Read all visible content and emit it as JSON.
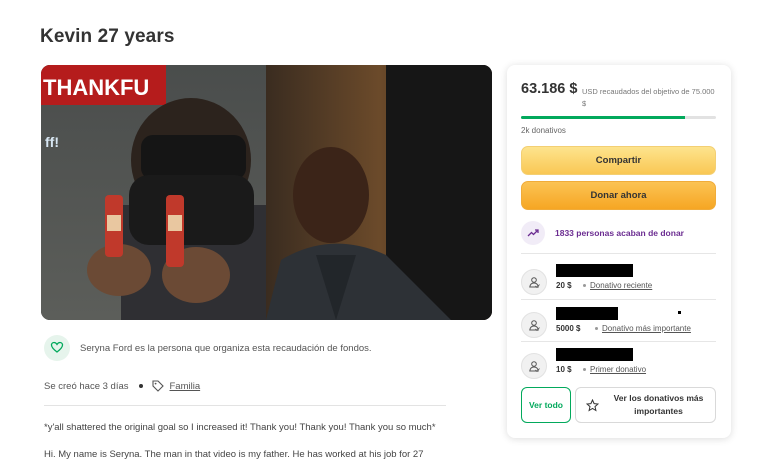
{
  "page": {
    "title": "Kevin 27 years"
  },
  "hero": {
    "sign_text": "THANKFU",
    "side_text": "ff!"
  },
  "organizer": {
    "text": "Seryna Ford es la persona que organiza esta recaudación de fondos."
  },
  "meta": {
    "created": "Se creó hace 3 días",
    "category": "Familia"
  },
  "story": {
    "paragraphs": [
      "*y'all shattered the original goal so I increased it! Thank you! Thank you! Thank you so much*",
      "Hi. My name is Seryna. The man in that video is my father. He has worked at his job for 27"
    ]
  },
  "campaign": {
    "raised_amount": "63.186 $",
    "raised_text": "USD recaudados del objetivo de 75.000 $",
    "progress_fraction": 0.8425,
    "donation_count": "2k donativos",
    "share_label": "Compartir",
    "donate_label": "Donar ahora",
    "recent_text": "1833 personas acaban de donar",
    "donors": [
      {
        "amount": "20 $",
        "label": "Donativo reciente"
      },
      {
        "amount": "5000 $",
        "label": "Donativo más importante"
      },
      {
        "amount": "10 $",
        "label": "Primer donativo"
      }
    ],
    "see_all_label": "Ver todo",
    "see_top_label": "Ver los donativos más importantes"
  },
  "colors": {
    "brand_green": "#02a95c",
    "share_yellow": "#f9c754",
    "donate_orange": "#f6a623",
    "recent_purple": "#6b2c91"
  }
}
